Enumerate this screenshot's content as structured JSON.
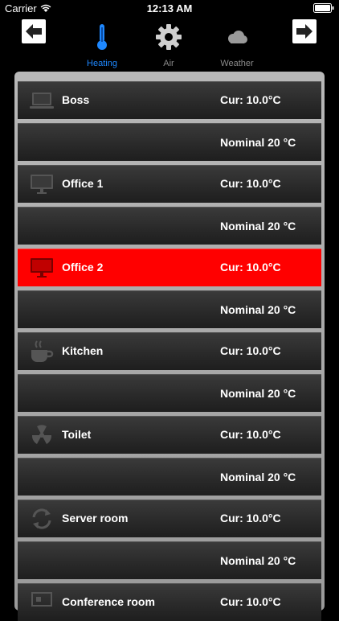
{
  "status_bar": {
    "carrier": "Carrier",
    "time": "12:13 AM"
  },
  "tabs": [
    {
      "label": "Heating",
      "icon": "thermometer-icon",
      "active": true
    },
    {
      "label": "Air",
      "icon": "gear-icon",
      "active": false
    },
    {
      "label": "Weather",
      "icon": "cloud-icon",
      "active": false
    }
  ],
  "rooms": [
    {
      "name": "Boss",
      "icon": "laptop-icon",
      "current": "Cur: 10.0°C",
      "nominal": "Nominal 20 °C",
      "active": false
    },
    {
      "name": "Office 1",
      "icon": "monitor-icon",
      "current": "Cur: 10.0°C",
      "nominal": "Nominal 20 °C",
      "active": false
    },
    {
      "name": "Office 2",
      "icon": "monitor-icon",
      "current": "Cur: 10.0°C",
      "nominal": "Nominal 20 °C",
      "active": true
    },
    {
      "name": "Kitchen",
      "icon": "coffee-cup-icon",
      "current": "Cur: 10.0°C",
      "nominal": "Nominal 20 °C",
      "active": false
    },
    {
      "name": "Toilet",
      "icon": "radiation-icon",
      "current": "Cur: 10.0°C",
      "nominal": "Nominal 20 °C",
      "active": false
    },
    {
      "name": "Server room",
      "icon": "sync-arrows-icon",
      "current": "Cur: 10.0°C",
      "nominal": "Nominal 20 °C",
      "active": false
    },
    {
      "name": "Conference room",
      "icon": "presentation-icon",
      "current": "Cur: 10.0°C",
      "nominal": "",
      "active": false
    }
  ],
  "colors": {
    "active_row": "#ff0000",
    "active_tab": "#1e88ff"
  }
}
